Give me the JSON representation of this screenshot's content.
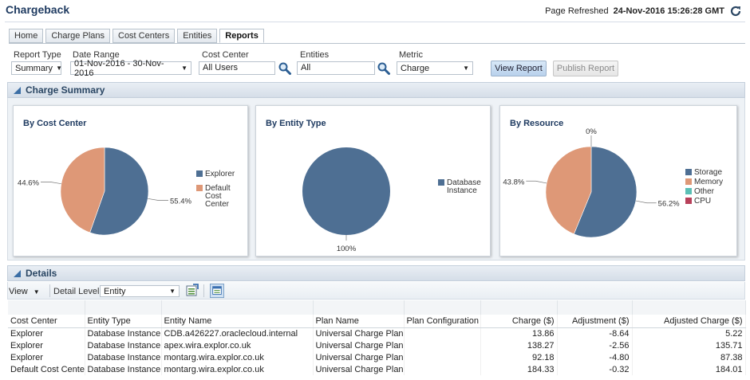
{
  "header": {
    "title": "Chargeback",
    "refresh_label": "Page Refreshed",
    "refresh_time": "24-Nov-2016 15:26:28 GMT"
  },
  "tabs": [
    {
      "label": "Home"
    },
    {
      "label": "Charge Plans"
    },
    {
      "label": "Cost Centers"
    },
    {
      "label": "Entities"
    },
    {
      "label": "Reports",
      "active": true
    }
  ],
  "filters": {
    "report_type": {
      "label": "Report Type",
      "value": "Summary"
    },
    "date_range": {
      "label": "Date Range",
      "value": "01-Nov-2016 - 30-Nov-2016"
    },
    "cost_center": {
      "label": "Cost Center",
      "value": "All Users"
    },
    "entities": {
      "label": "Entities",
      "value": "All"
    },
    "metric": {
      "label": "Metric",
      "value": "Charge"
    }
  },
  "buttons": {
    "view_report": "View Report",
    "publish_report": "Publish Report"
  },
  "summary_section": {
    "title": "Charge Summary"
  },
  "details_section": {
    "title": "Details"
  },
  "toolbar": {
    "view_label": "View",
    "detail_level_label": "Detail Level",
    "detail_level_value": "Entity"
  },
  "colors": {
    "blue": "#4e6f93",
    "orange": "#de9877",
    "teal": "#5bbfb5",
    "crimson": "#b8405a"
  },
  "chart_data": [
    {
      "type": "pie",
      "title": "By Cost Center",
      "slices": [
        {
          "name": "Explorer",
          "value": 55.4,
          "label": "55.4%",
          "color": "#4e6f93"
        },
        {
          "name": "Default Cost Center",
          "value": 44.6,
          "label": "44.6%",
          "color": "#de9877"
        }
      ],
      "legend": [
        "Explorer",
        "Default Cost Center"
      ]
    },
    {
      "type": "pie",
      "title": "By Entity Type",
      "slices": [
        {
          "name": "Database Instance",
          "value": 100,
          "label": "100%",
          "color": "#4e6f93"
        }
      ],
      "legend": [
        "Database Instance"
      ]
    },
    {
      "type": "pie",
      "title": "By Resource",
      "slices": [
        {
          "name": "Storage",
          "value": 56.2,
          "label": "56.2%",
          "color": "#4e6f93"
        },
        {
          "name": "Memory",
          "value": 43.8,
          "label": "43.8%",
          "color": "#de9877"
        },
        {
          "name": "Other",
          "value": 0,
          "label": "0%",
          "color": "#5bbfb5"
        },
        {
          "name": "CPU",
          "value": 0,
          "label": "",
          "color": "#b8405a"
        }
      ],
      "legend": [
        "Storage",
        "Memory",
        "Other",
        "CPU"
      ]
    }
  ],
  "table": {
    "columns": [
      "Cost Center",
      "Entity Type",
      "Entity Name",
      "Plan Name",
      "Plan Configuration",
      "Charge ($)",
      "Adjustment ($)",
      "Adjusted Charge ($)"
    ],
    "rows": [
      [
        "Explorer",
        "Database Instance",
        "CDB.a426227.oraclecloud.internal",
        "Universal Charge Plan",
        "",
        "13.86",
        "-8.64",
        "5.22"
      ],
      [
        "Explorer",
        "Database Instance",
        "apex.wira.explor.co.uk",
        "Universal Charge Plan",
        "",
        "138.27",
        "-2.56",
        "135.71"
      ],
      [
        "Explorer",
        "Database Instance",
        "montarg.wira.explor.co.uk",
        "Universal Charge Plan",
        "",
        "92.18",
        "-4.80",
        "87.38"
      ],
      [
        "Default Cost Center",
        "Database Instance",
        "montarg.wira.explor.co.uk",
        "Universal Charge Plan",
        "",
        "184.33",
        "-0.32",
        "184.01"
      ]
    ]
  }
}
